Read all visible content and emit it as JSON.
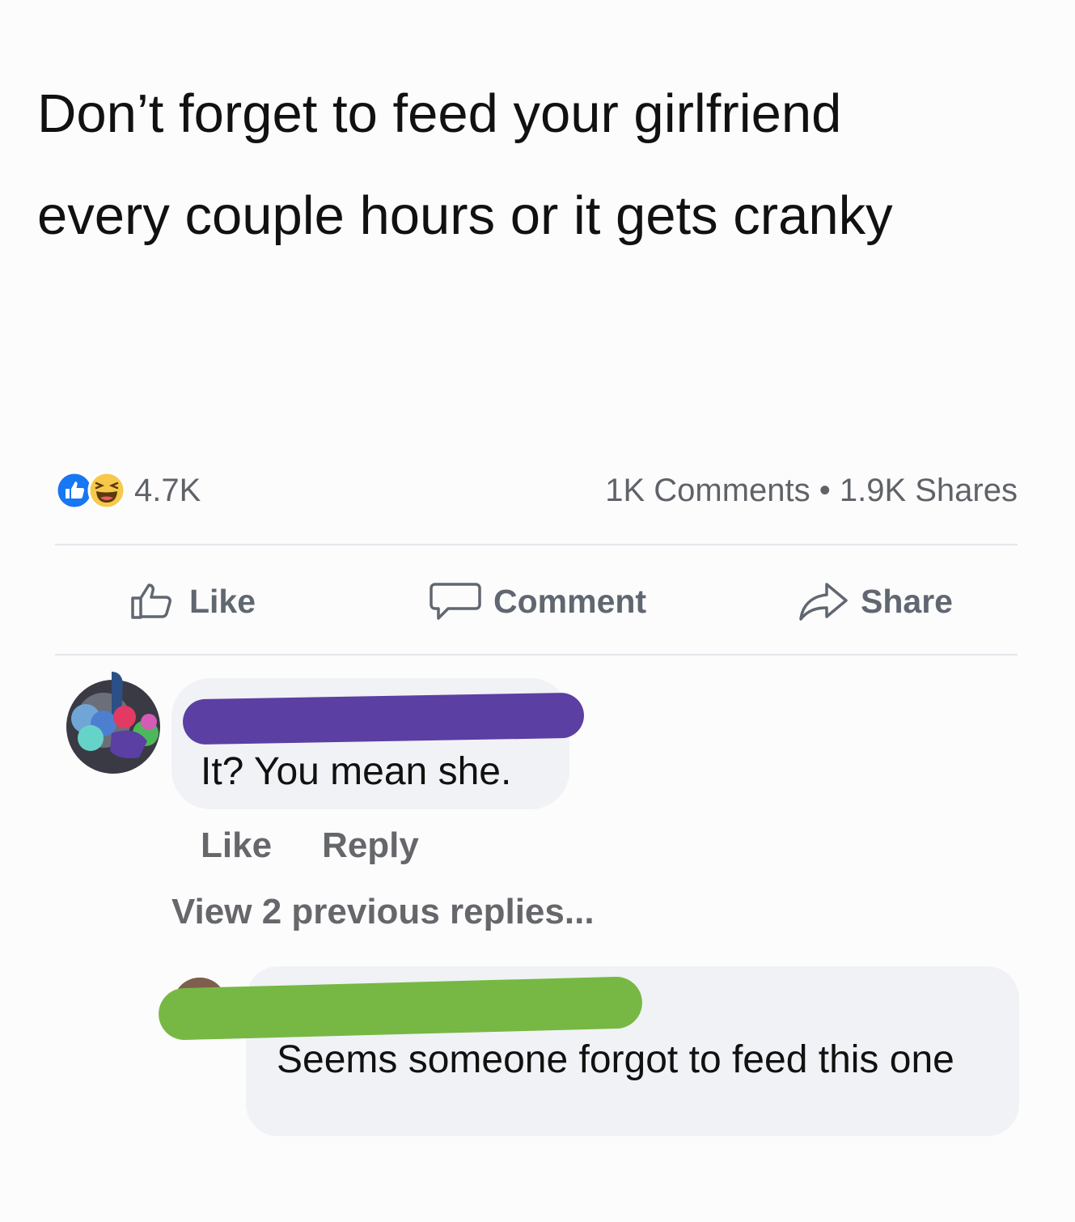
{
  "post": {
    "text_line1": "Don’t forget to feed your girlfriend",
    "text_line2": "every couple hours or it gets cranky"
  },
  "stats": {
    "reaction_count": "4.7K",
    "comments_shares": "1K Comments • 1.9K Shares"
  },
  "reaction_icons": [
    "like-reaction-icon",
    "haha-reaction-icon"
  ],
  "actions": {
    "like_label": "Like",
    "comment_label": "Comment",
    "share_label": "Share"
  },
  "comment1": {
    "author": "",
    "text": "It? You mean she.",
    "like_label": "Like",
    "reply_label": "Reply"
  },
  "view_replies_label": "View 2 previous replies...",
  "reply1": {
    "author": "",
    "text": "Seems someone forgot to feed this one"
  },
  "colors": {
    "like_blue": "#1877f2",
    "haha_yellow": "#f7c94b",
    "scribble_purple": "#5b3fa3",
    "scribble_green": "#76b843",
    "bubble_gray": "#f0f2f5"
  }
}
